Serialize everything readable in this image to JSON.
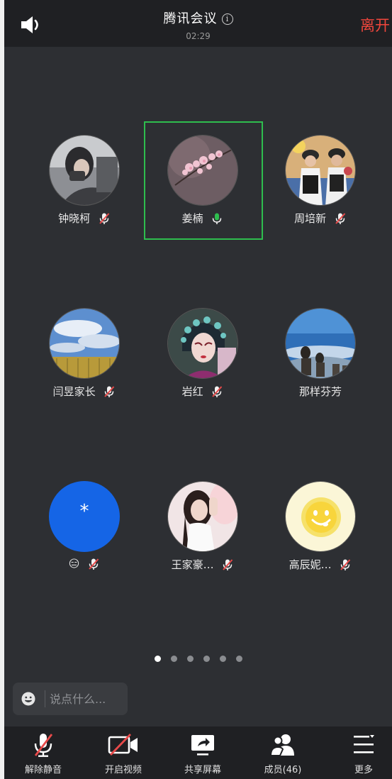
{
  "header": {
    "title": "腾讯会议",
    "timer": "02:29",
    "leave_label": "离开"
  },
  "participants": [
    {
      "name": "钟晓柯",
      "muted": true
    },
    {
      "name": "姜楠",
      "muted": false,
      "speaking": true
    },
    {
      "name": "周培新",
      "muted": true
    },
    {
      "name": "闫昱家长",
      "muted": true
    },
    {
      "name": "岩红",
      "muted": true
    },
    {
      "name": "那样芬芳",
      "muted": false
    },
    {
      "name": "😑",
      "muted": true,
      "avatar_text": "*"
    },
    {
      "name": "王家豪…",
      "muted": true
    },
    {
      "name": "高辰妮…",
      "muted": true
    }
  ],
  "pager": {
    "total_pages": 6,
    "current_page": 1
  },
  "chat": {
    "placeholder": "说点什么..."
  },
  "toolbar": {
    "unmute_label": "解除静音",
    "video_label": "开启视频",
    "share_label": "共享屏幕",
    "members_label": "成员(46)",
    "more_label": "更多"
  },
  "colors": {
    "background": "#2d2f33",
    "bar": "#1f2023",
    "leave": "#f0463c",
    "speaking": "#2ebd4e",
    "mute_slash": "#e84a4a"
  }
}
